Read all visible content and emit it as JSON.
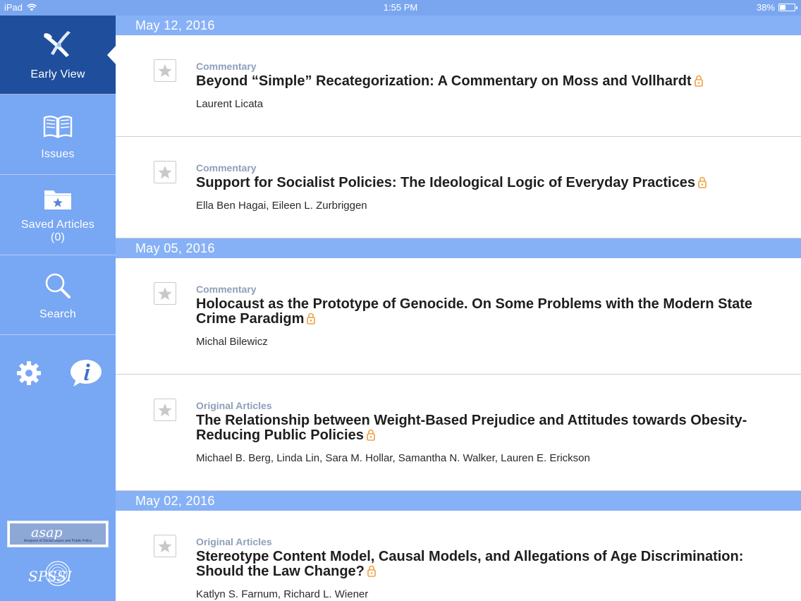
{
  "status_bar": {
    "device": "iPad",
    "time": "1:55 PM",
    "battery_text": "38%",
    "battery_level": 0.38
  },
  "sidebar": {
    "nav": [
      {
        "label": "Early View",
        "icon": "early-view-icon",
        "active": true
      },
      {
        "label": "Issues",
        "icon": "open-book-icon",
        "active": false
      },
      {
        "label": "Saved Articles",
        "count": "(0)",
        "icon": "starred-folder-icon",
        "active": false
      },
      {
        "label": "Search",
        "icon": "search-icon",
        "active": false
      }
    ],
    "utilities": [
      {
        "icon": "gear-icon"
      },
      {
        "icon": "info-bubble-icon"
      }
    ],
    "logos": {
      "asap": "asap",
      "asap_sub": "Analyses of Social Issues and Public Policy",
      "spssi": "SPSSI"
    }
  },
  "groups": [
    {
      "date": "May 12, 2016",
      "articles": [
        {
          "category": "Commentary",
          "title": "Beyond “Simple” Recategorization: A Commentary on Moss and Vollhardt",
          "authors": "Laurent Licata"
        },
        {
          "category": "Commentary",
          "title": "Support for Socialist Policies: The Ideological Logic of Everyday Practices",
          "authors": "Ella Ben Hagai, Eileen L. Zurbriggen"
        }
      ]
    },
    {
      "date": "May 05, 2016",
      "articles": [
        {
          "category": "Commentary",
          "title": "Holocaust as the Prototype of Genocide. On Some Problems with the Modern State Crime Paradigm",
          "authors": "Michal Bilewicz"
        },
        {
          "category": "Original Articles",
          "title": "The Relationship between Weight-Based Prejudice and Attitudes towards Obesity-Reducing Public Policies",
          "authors": "Michael B. Berg, Linda Lin, Sara M. Hollar, Samantha N. Walker, Lauren E. Erickson"
        }
      ]
    },
    {
      "date": "May 02, 2016",
      "articles": [
        {
          "category": "Original Articles",
          "title": "Stereotype Content Model, Causal Models, and Allegations of Age Discrimination: Should the Law Change?",
          "authors": "Katlyn S. Farnum, Richard L. Wiener"
        }
      ]
    }
  ],
  "colors": {
    "sidebar": "#78a7f3",
    "sidebar_active": "#1f4f9c",
    "date_header": "#87b1f6",
    "lock": "#f0a040",
    "category": "#8ea0b8"
  }
}
